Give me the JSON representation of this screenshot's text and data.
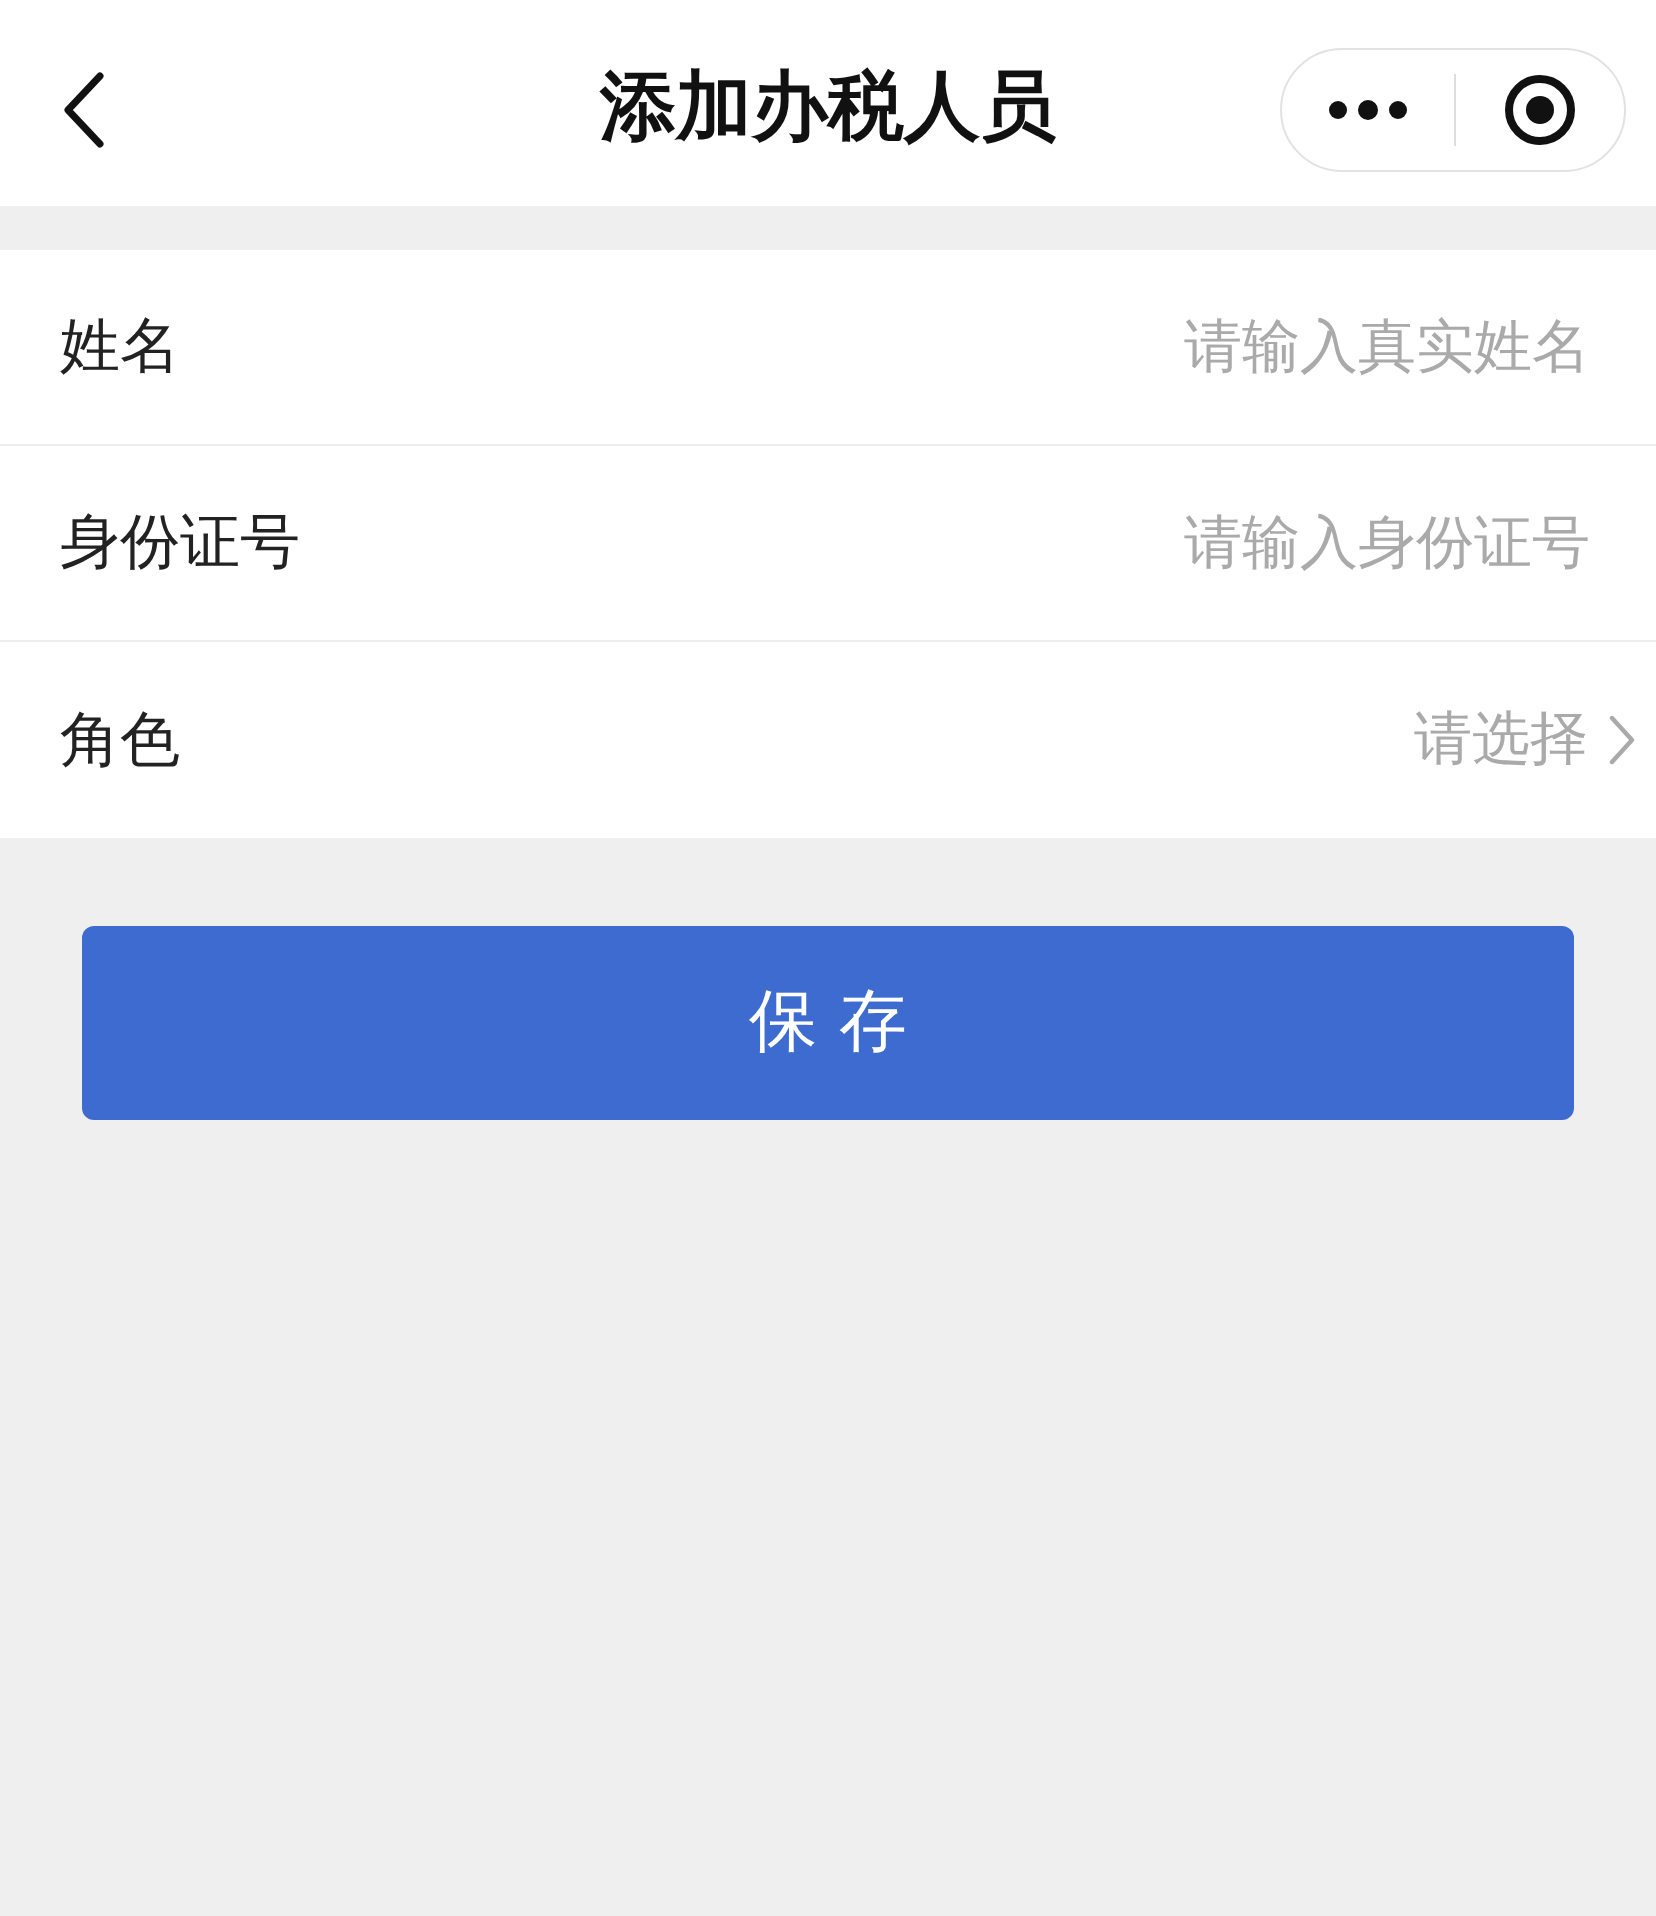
{
  "nav_bar": {
    "title": "添加办税人员"
  },
  "form": {
    "fields": [
      {
        "kind": "input",
        "label": "姓名",
        "placeholder": "请输入真实姓名"
      },
      {
        "kind": "input",
        "label": "身份证号",
        "placeholder": "请输入身份证号"
      },
      {
        "kind": "select",
        "label": "角色",
        "placeholder": "请选择"
      }
    ]
  },
  "save_button": {
    "label": "保 存"
  }
}
